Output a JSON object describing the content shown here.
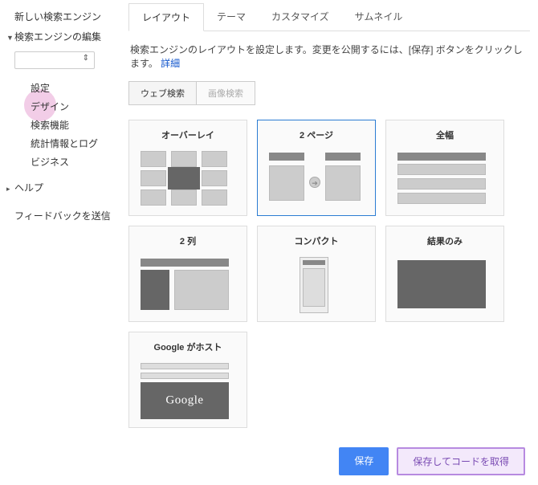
{
  "sidebar": {
    "nav": {
      "new_engine": "新しい検索エンジン",
      "edit_engine": "検索エンジンの編集",
      "help": "ヘルプ"
    },
    "sub": {
      "settings": "設定",
      "design": "デザイン",
      "search_features": "検索機能",
      "stats_logs": "統計情報とログ",
      "business": "ビジネス"
    },
    "feedback": "フィードバックを送信"
  },
  "tabs": {
    "layout": "レイアウト",
    "theme": "テーマ",
    "customize": "カスタマイズ",
    "thumbnail": "サムネイル"
  },
  "desc_text": "検索エンジンのレイアウトを設定します。変更を公開するには、[保存] ボタンをクリックします。",
  "desc_link": "詳細",
  "subtabs": {
    "web": "ウェブ検索",
    "image": "画像検索"
  },
  "layouts": {
    "overlay": "オーバーレイ",
    "two_page": "2 ページ",
    "full_width": "全幅",
    "two_column": "2 列",
    "compact": "コンパクト",
    "results_only": "結果のみ",
    "google_hosted": "Google がホスト"
  },
  "google_text": "Google",
  "buttons": {
    "save": "保存",
    "save_get_code": "保存してコードを取得"
  }
}
